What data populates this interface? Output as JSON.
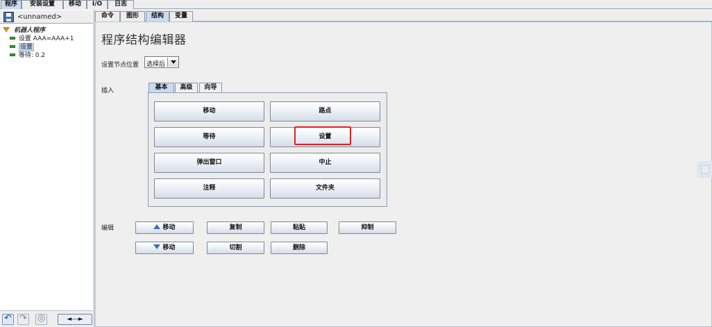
{
  "top_tabs": [
    "程序",
    "安装设置",
    "移动",
    "I/O",
    "日志"
  ],
  "file": {
    "name": "<unnamed>"
  },
  "tree": {
    "root": "机器人程序",
    "items": [
      {
        "label": "设置 AAA=AAA+1",
        "selected": false
      },
      {
        "label": "设置",
        "selected": true
      },
      {
        "label": "等待: 0.2",
        "selected": false
      }
    ]
  },
  "sub_tabs": [
    "命令",
    "图形",
    "结构",
    "变量"
  ],
  "main": {
    "title": "程序结构编辑器",
    "set_node_position_label": "设置节点位置",
    "position_select_value": "选择后"
  },
  "insert": {
    "label": "插入",
    "tabs": [
      "基本",
      "高级",
      "向导"
    ],
    "buttons": [
      "移动",
      "路点",
      "等待",
      "设置",
      "弹出窗口",
      "中止",
      "注释",
      "文件夹"
    ]
  },
  "edit": {
    "label": "编辑",
    "buttons": [
      "移动",
      "复制",
      "粘贴",
      "抑制",
      "移动",
      "切割",
      "删除"
    ]
  },
  "nav": {
    "wide_arrow": "◄---►"
  },
  "colors": {
    "highlight": "#e32121",
    "active_tab": "#c8dcf2"
  }
}
